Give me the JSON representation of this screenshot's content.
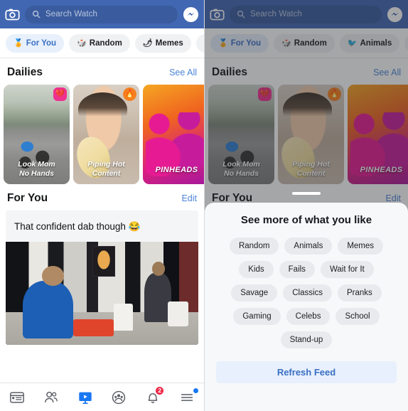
{
  "header": {
    "camera_icon": "camera-icon",
    "search_placeholder": "Search Watch",
    "search_icon": "search-icon",
    "messenger_icon": "messenger-icon"
  },
  "chips_left": [
    {
      "emoji": "🏅",
      "label": "For You",
      "selected": true
    },
    {
      "emoji": "🎲",
      "label": "Random",
      "selected": false
    },
    {
      "emoji": "🌶",
      "label": "Memes",
      "selected": false
    },
    {
      "emoji": "🎒",
      "label": "",
      "selected": false
    }
  ],
  "chips_right": [
    {
      "emoji": "🏅",
      "label": "For You",
      "selected": true
    },
    {
      "emoji": "🎲",
      "label": "Random",
      "selected": false
    },
    {
      "emoji": "🐦",
      "label": "Animals",
      "selected": false
    },
    {
      "emoji": "🌶",
      "label": "",
      "selected": false
    }
  ],
  "dailies": {
    "title": "Dailies",
    "see_all": "See All",
    "cards": [
      {
        "caption": "Look Mom\nNo Hands",
        "badge": "💔",
        "badge_style": "pink"
      },
      {
        "caption": "Piping Hot\nContent",
        "badge": "🔥",
        "badge_style": "orange"
      },
      {
        "caption": "PINHEADS",
        "badge": "",
        "badge_style": "none"
      }
    ]
  },
  "for_you": {
    "title": "For You",
    "edit": "Edit",
    "post_text": "That confident dab though 😂"
  },
  "tabbar": {
    "items": [
      {
        "name": "news-feed",
        "badge": ""
      },
      {
        "name": "friends",
        "badge": ""
      },
      {
        "name": "watch",
        "badge": "",
        "active": true
      },
      {
        "name": "groups",
        "badge": ""
      },
      {
        "name": "notifications",
        "badge": "2"
      },
      {
        "name": "menu",
        "badge": ""
      }
    ]
  },
  "sheet": {
    "title": "See more of what you like",
    "tag_rows": [
      [
        "Random",
        "Animals",
        "Memes"
      ],
      [
        "Kids",
        "Fails",
        "Wait for It"
      ],
      [
        "Savage",
        "Classics",
        "Pranks"
      ],
      [
        "Gaming",
        "Celebs",
        "School"
      ],
      [
        "Stand-up"
      ]
    ],
    "refresh_label": "Refresh Feed"
  },
  "colors": {
    "header_blue": "#4267b2",
    "accent_link": "#4b84d6",
    "chip_selected_bg": "#e7f0fb",
    "badge_red": "#f02849",
    "watch_blue": "#1877f2"
  }
}
